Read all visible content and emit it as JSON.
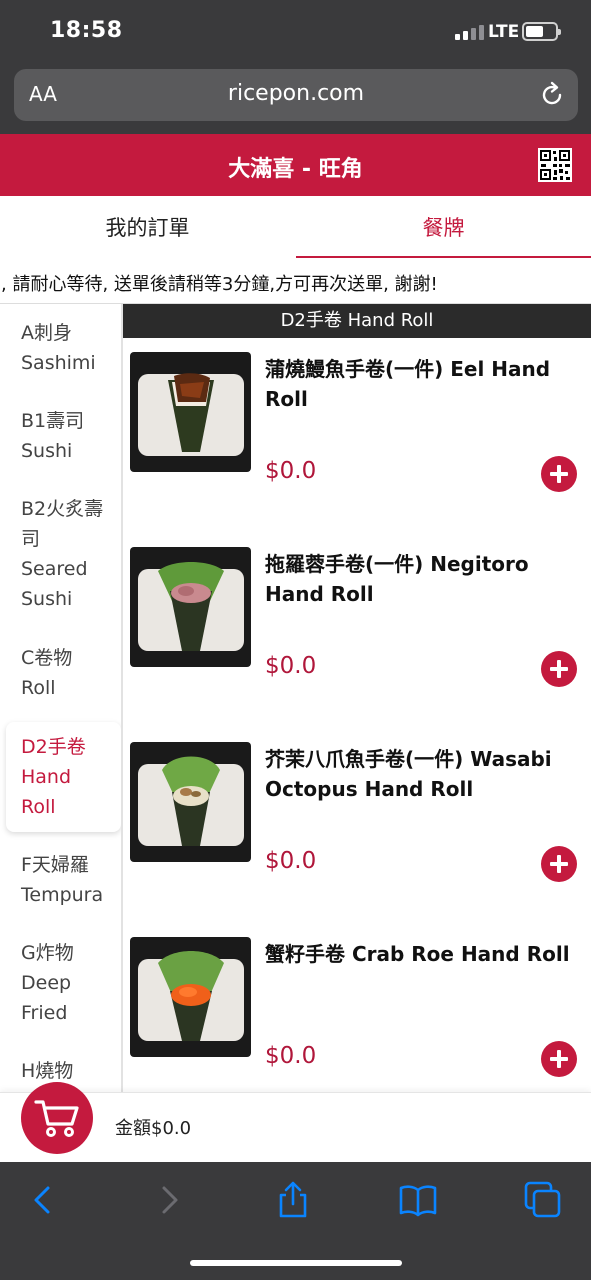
{
  "status_bar": {
    "time": "18:58",
    "network": "LTE",
    "battery_fraction": 0.6
  },
  "browser": {
    "text_size_label": "AA",
    "url": "ricepon.com"
  },
  "header": {
    "store_title": "大滿喜 - 旺角"
  },
  "tabs": [
    {
      "label": "我的訂單",
      "active": false
    },
    {
      "label": "餐牌",
      "active": true
    }
  ],
  "notice": "], 請耐心等待, 送單後請稍等3分鐘,方可再次送單, 謝謝!",
  "sidebar": {
    "items": [
      {
        "lines": [
          "A刺身",
          "Sashimi"
        ],
        "active": false
      },
      {
        "lines": [
          "B1壽司",
          "Sushi"
        ],
        "active": false
      },
      {
        "lines": [
          "B2火炙壽",
          "司",
          "Seared",
          "Sushi"
        ],
        "active": false
      },
      {
        "lines": [
          "C卷物",
          "Roll"
        ],
        "active": false
      },
      {
        "lines": [
          "D2手卷",
          "Hand",
          "Roll"
        ],
        "active": true
      },
      {
        "lines": [
          "F天婦羅",
          "Tempura"
        ],
        "active": false
      },
      {
        "lines": [
          "G炸物",
          "Deep",
          "Fried"
        ],
        "active": false
      },
      {
        "lines": [
          "H燒物"
        ],
        "active": false
      }
    ]
  },
  "category": {
    "title": "D2手卷 Hand Roll"
  },
  "items": [
    {
      "name": "蒲燒鰻魚手卷(一件) Eel Hand Roll",
      "price": "$0.0"
    },
    {
      "name": "拖羅蓉手卷(一件) Negitoro Hand Roll",
      "price": "$0.0"
    },
    {
      "name": "芥茉八爪魚手卷(一件) Wasabi Octopus Hand Roll",
      "price": "$0.0"
    },
    {
      "name": "蟹籽手卷 Crab Roe Hand Roll",
      "price": "$0.0"
    }
  ],
  "cart": {
    "total_label": "金額$0.0"
  },
  "icons": {
    "reload": "reload-icon",
    "qr": "qr-code-icon",
    "cart": "shopping-cart-icon",
    "add": "plus-icon",
    "back": "chevron-left-icon",
    "forward": "chevron-right-icon",
    "share": "share-icon",
    "bookmarks": "book-icon",
    "tabs": "tabs-icon"
  },
  "colors": {
    "brand": "#c41a3e",
    "price": "#b0163a",
    "chrome": "#3a3a3c",
    "ios_blue": "#0a84ff"
  }
}
